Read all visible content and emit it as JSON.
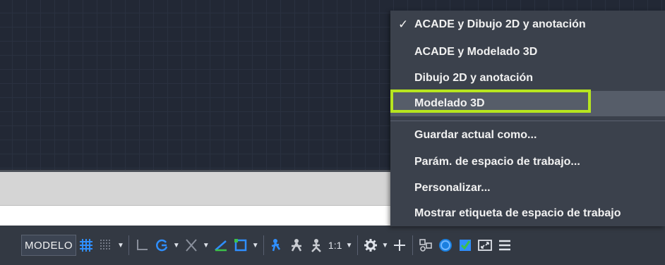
{
  "workspace_menu": {
    "items": [
      {
        "label": "ACADE y Dibujo 2D y anotación",
        "checked": true
      },
      {
        "label": "ACADE y Modelado 3D",
        "checked": false
      },
      {
        "label": "Dibujo 2D y anotación",
        "checked": false
      },
      {
        "label": "Modelado 3D",
        "checked": false,
        "highlighted": true
      },
      {
        "label": "Guardar actual como...",
        "checked": false
      },
      {
        "label": "Parám. de espacio de trabajo...",
        "checked": false
      },
      {
        "label": "Personalizar...",
        "checked": false
      },
      {
        "label": "Mostrar etiqueta de espacio de trabajo",
        "checked": false
      }
    ],
    "check_glyph": "✓",
    "highlight_color": "#b7e51f"
  },
  "statusbar": {
    "model_label": "MODELO",
    "scale_label": "1:1",
    "icons": [
      "grid-icon",
      "snap-mode-icon",
      "ortho-icon",
      "polar-tracking-icon",
      "isometric-drafting-icon",
      "object-snap-tracking-icon",
      "object-snap-icon",
      "annotation-visibility-icon",
      "auto-scale-icon",
      "annotation-scale-icon",
      "workspace-switch-gear-icon",
      "plus-icon",
      "isolate-objects-icon",
      "hardware-acceleration-icon",
      "quick-properties-icon",
      "clean-screen-icon",
      "customization-menu-icon"
    ]
  },
  "colors": {
    "canvas_bg": "#222835",
    "menu_bg": "#3b414c",
    "statusbar_bg": "#333943",
    "accent_blue": "#1a7fe0"
  }
}
